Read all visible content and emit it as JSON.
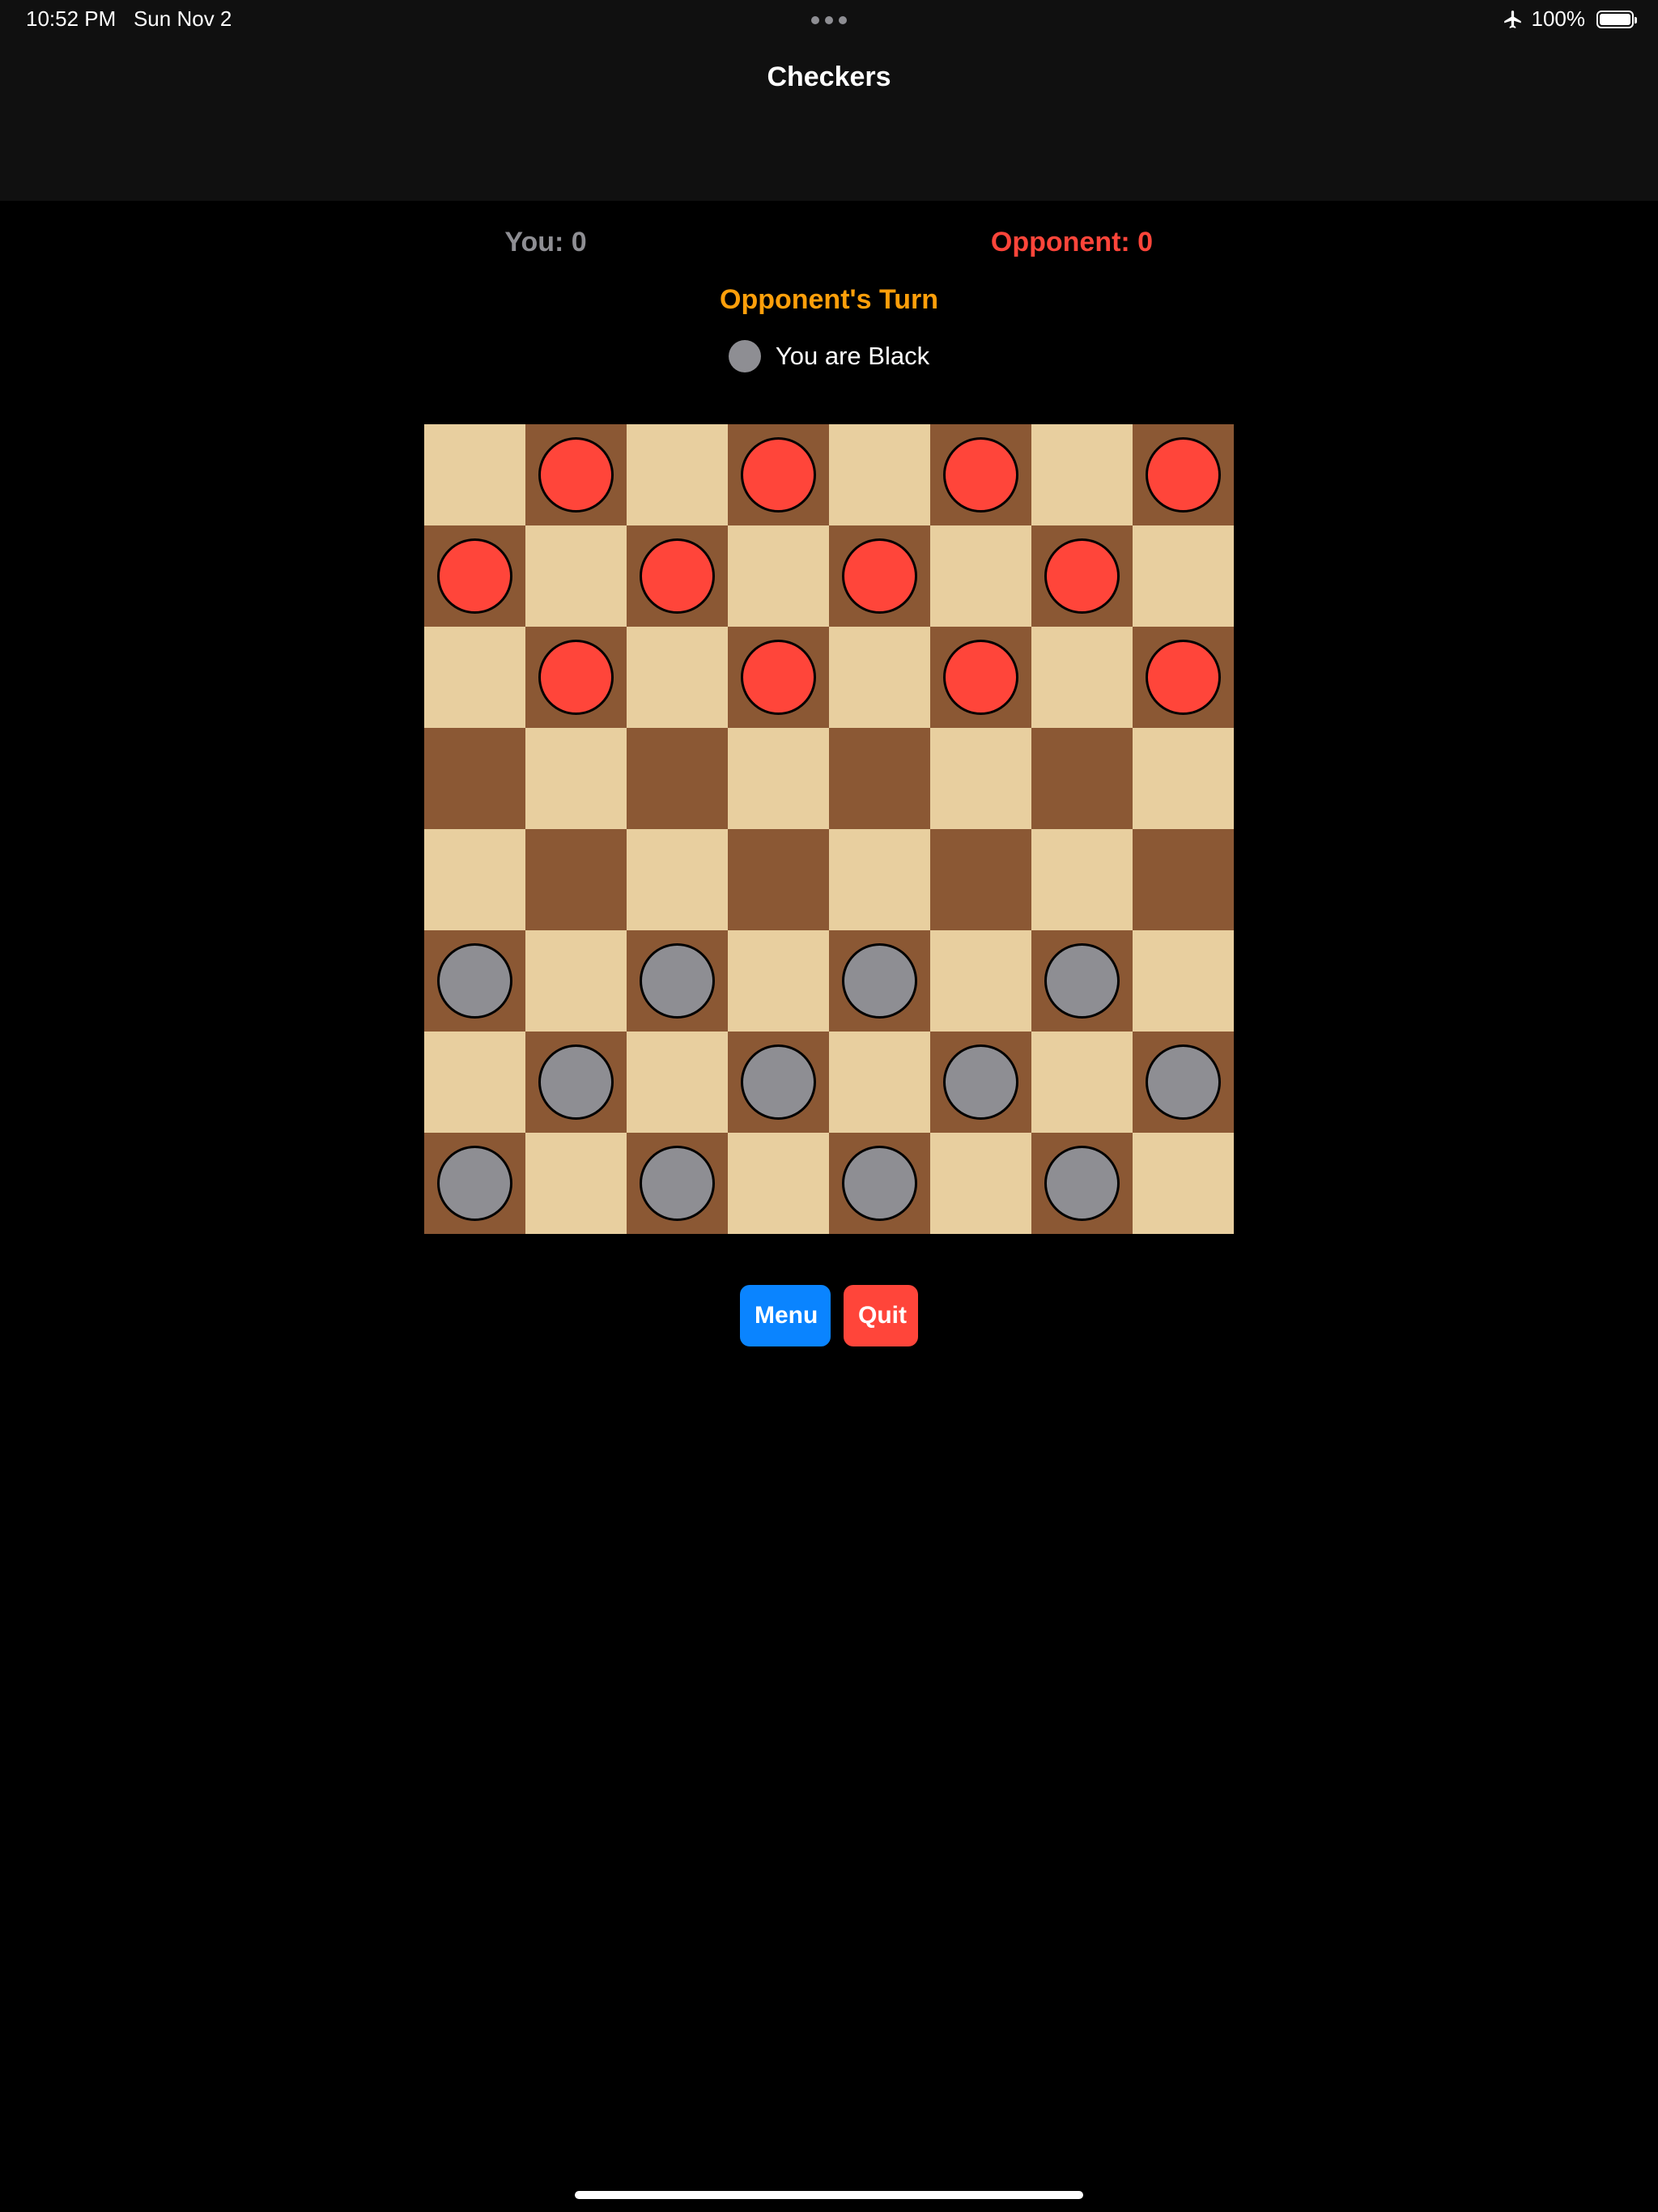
{
  "status_bar": {
    "time": "10:52 PM",
    "date": "Sun Nov 2",
    "battery": "100%",
    "icons": [
      "airplane-icon",
      "battery-icon",
      "multitasking-dots-icon"
    ]
  },
  "nav": {
    "title": "Checkers"
  },
  "scores": {
    "you": "You: 0",
    "opponent": "Opponent: 0"
  },
  "turn": "Opponent's Turn",
  "player_color": {
    "label": "You are Black",
    "color": "#8e8e93"
  },
  "board": {
    "size": 8,
    "light_color": "#e8cf9f",
    "dark_color": "#8b5834",
    "rows": [
      ". r . r . r . r",
      "r . r . r . r .",
      ". r . r . r . r",
      ". . . . . . . .",
      ". . . . . . . .",
      "b . b . b . b .",
      ". b . b . b . b",
      "b . b . b . b ."
    ],
    "piece_colors": {
      "r": "#ff453a",
      "b": "#8e8e93"
    }
  },
  "buttons": {
    "menu": "Menu",
    "quit": "Quit"
  },
  "colors": {
    "you_score": "#8e8e93",
    "opponent_score": "#ff453a",
    "turn": "#ff9f0a",
    "menu_button": "#0a84ff",
    "quit_button": "#ff453a"
  }
}
